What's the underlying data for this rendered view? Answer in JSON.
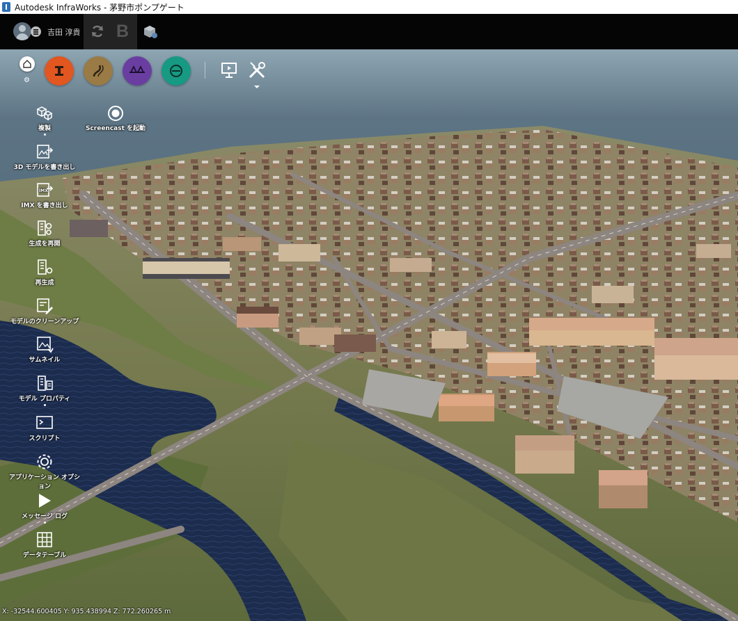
{
  "window": {
    "title": "Autodesk InfraWorks - 茅野市ポンプゲート"
  },
  "topbar": {
    "username": "吉田 淳貴",
    "icons": [
      "avatar",
      "menu-icon",
      "sync-icon",
      "bim-icon",
      "cube-settings-icon"
    ]
  },
  "toolbar": {
    "home_icon": "home-icon",
    "tools": [
      {
        "name": "design-roads-tool",
        "color": "#e2561f"
      },
      {
        "name": "terrain-tool",
        "color": "#9a7b45"
      },
      {
        "name": "bridge-tool",
        "color": "#6a3ea1"
      },
      {
        "name": "drainage-tool",
        "color": "#169a83"
      }
    ],
    "present_icon": "presentation-icon",
    "settings_icon": "tools-wrench-icon"
  },
  "side_menu": [
    {
      "id": "replicate",
      "label": "複製",
      "icon": "cubes-icon"
    },
    {
      "id": "export-3d",
      "label": "3D モデルを書き出し",
      "icon": "export-3d-icon"
    },
    {
      "id": "export-imx",
      "label": "IMX を書き出し",
      "icon": "imx-icon"
    },
    {
      "id": "regenerate-with",
      "label": "生成を再開",
      "icon": "building-gear-icon"
    },
    {
      "id": "regenerate",
      "label": "再生成",
      "icon": "building-gear-icon"
    },
    {
      "id": "cleanup",
      "label": "モデルのクリーンアップ",
      "icon": "cleanup-icon"
    },
    {
      "id": "thumbnail",
      "label": "サムネイル",
      "icon": "thumbnail-icon"
    },
    {
      "id": "properties",
      "label": "モデル プロパティ",
      "icon": "properties-icon"
    },
    {
      "id": "script",
      "label": "スクリプト",
      "icon": "script-icon"
    },
    {
      "id": "app-options",
      "label": "アプリケーション オプション",
      "icon": "gear-icon"
    },
    {
      "id": "message-log",
      "label": "メッセージ ログ",
      "icon": "play-flag-icon"
    },
    {
      "id": "data-table",
      "label": "データテーブル",
      "icon": "table-icon"
    }
  ],
  "screencast": {
    "label": "Screencast を起動",
    "icon": "record-icon"
  },
  "status": {
    "coordinates": "X: -32544.600405 Y: 935.438994 Z: 772.260265 m"
  },
  "colors": {
    "sky_top": "#7e98a8",
    "lake": "#35505e",
    "river": "#1d2d4f",
    "ground": "#7f8456",
    "road": "#8b8480"
  }
}
